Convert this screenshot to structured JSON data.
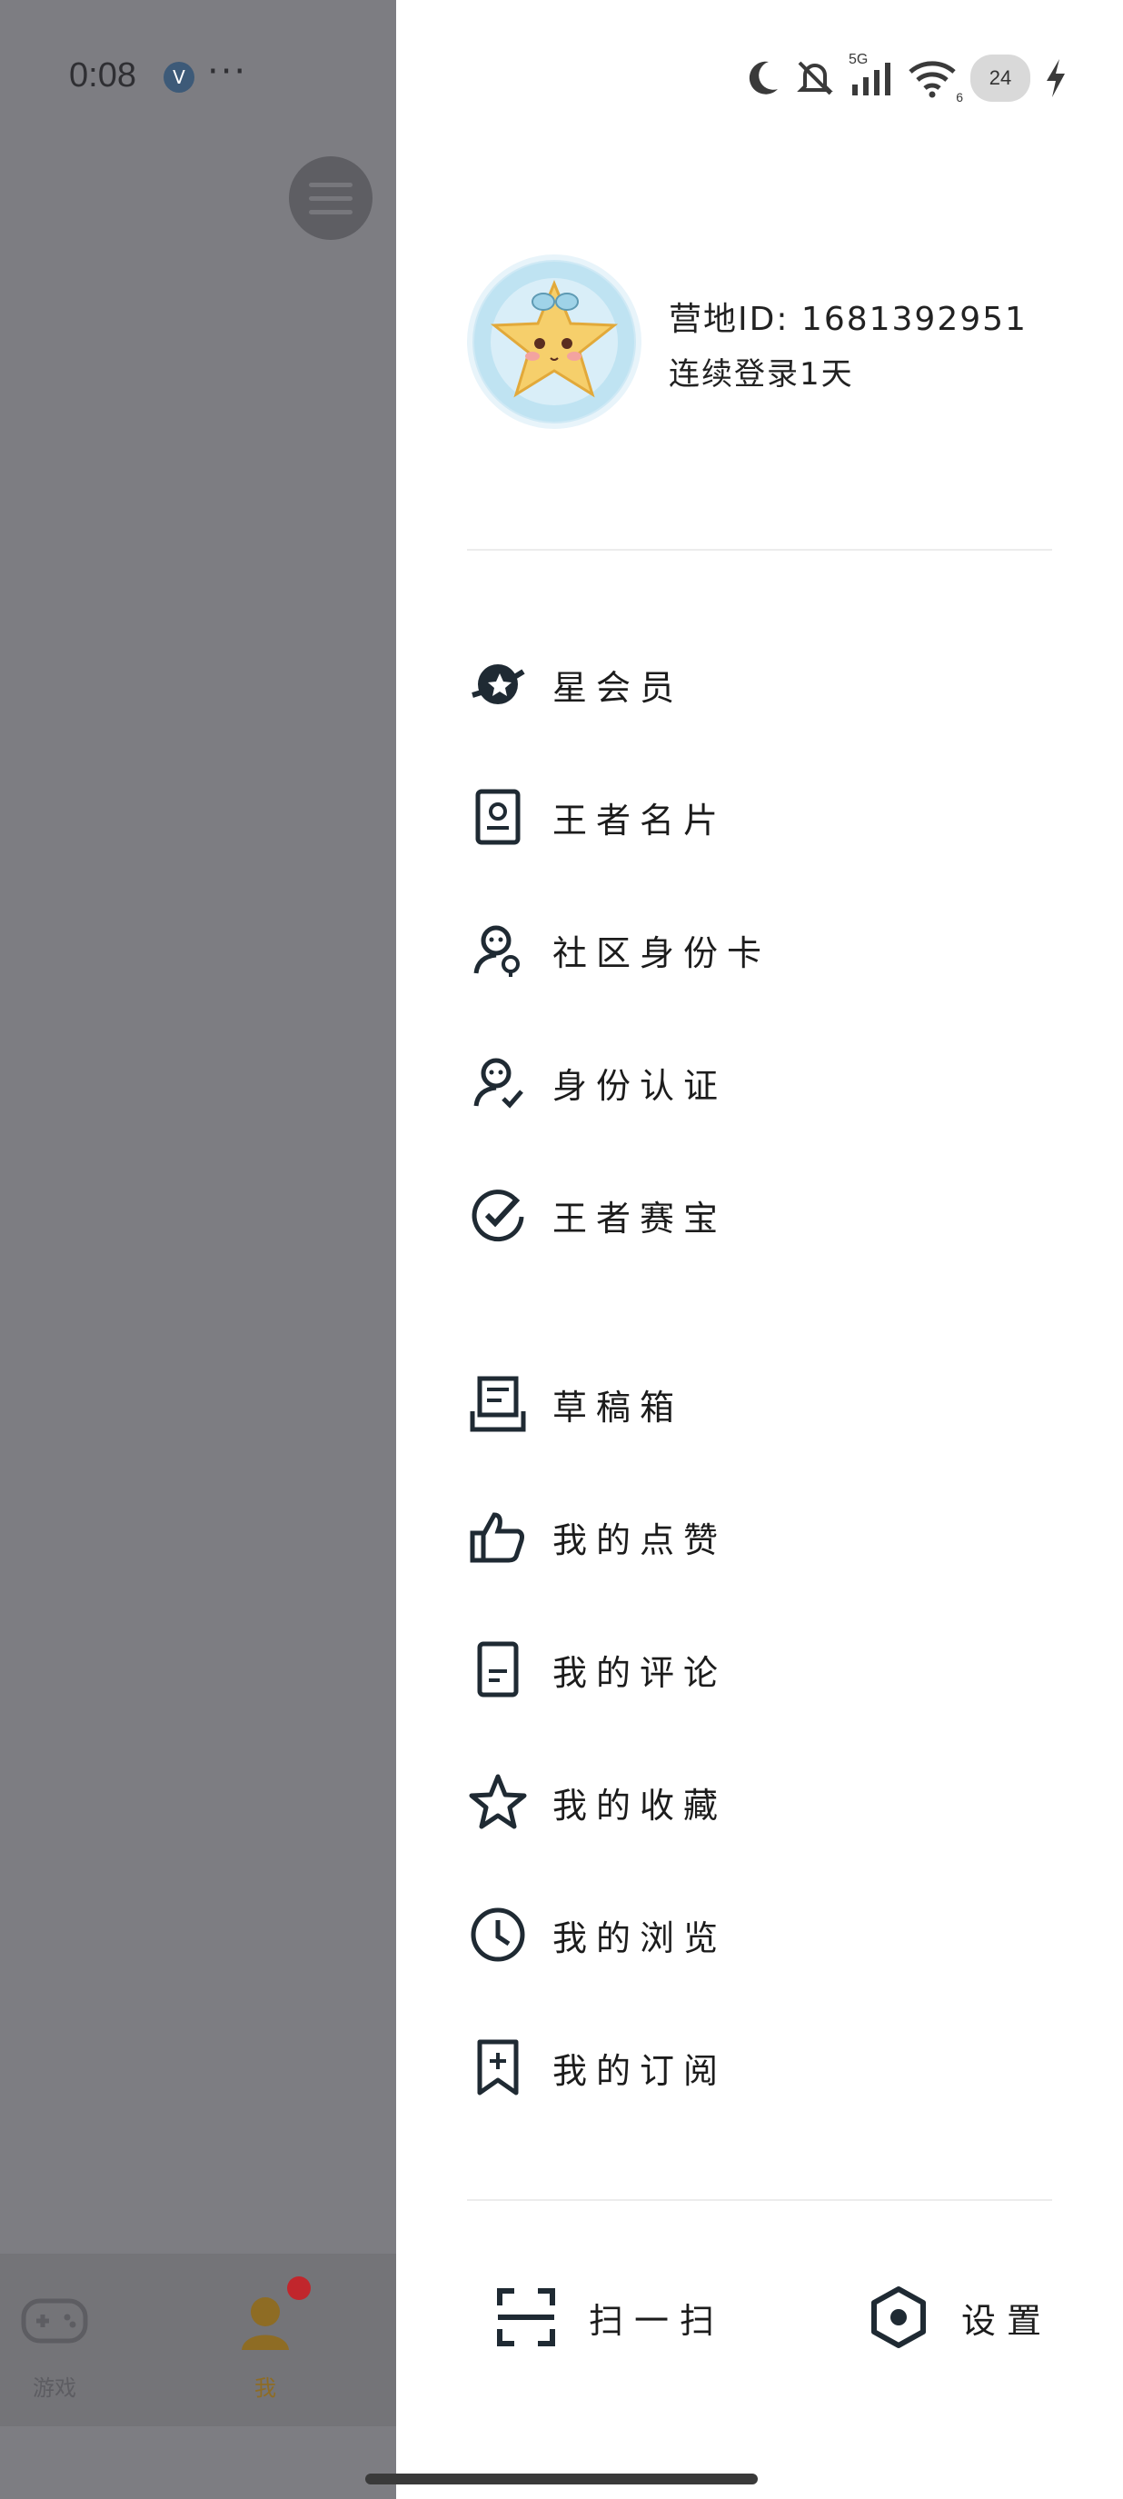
{
  "status_bar": {
    "time": "0:08",
    "network": "5G",
    "wifi_level": "6",
    "battery": "24"
  },
  "background_app": {
    "nav": {
      "games_label": "游戏",
      "me_label": "我"
    }
  },
  "drawer": {
    "profile": {
      "id_text": "营地ID: 1681392951",
      "login_text": "连续登录1天"
    },
    "group1": [
      {
        "label": "星会员",
        "icon": "star-member-icon"
      },
      {
        "label": "王者名片",
        "icon": "name-card-icon"
      },
      {
        "label": "社区身份卡",
        "icon": "community-id-icon"
      },
      {
        "label": "身份认证",
        "icon": "verification-icon"
      },
      {
        "label": "王者赛宝",
        "icon": "match-treasure-icon"
      }
    ],
    "group2": [
      {
        "label": "草稿箱",
        "icon": "drafts-icon"
      },
      {
        "label": "我的点赞",
        "icon": "thumbs-up-icon"
      },
      {
        "label": "我的评论",
        "icon": "comment-icon"
      },
      {
        "label": "我的收藏",
        "icon": "star-icon"
      },
      {
        "label": "我的浏览",
        "icon": "clock-icon"
      },
      {
        "label": "我的订阅",
        "icon": "bookmark-add-icon"
      }
    ],
    "actions": {
      "scan_label": "扫一扫",
      "settings_label": "设置"
    }
  },
  "colors": {
    "overlay": "#7d7d82",
    "drawer_bg": "#ffffff",
    "icon": "#1f2a33",
    "badge_red": "#c1262c"
  }
}
